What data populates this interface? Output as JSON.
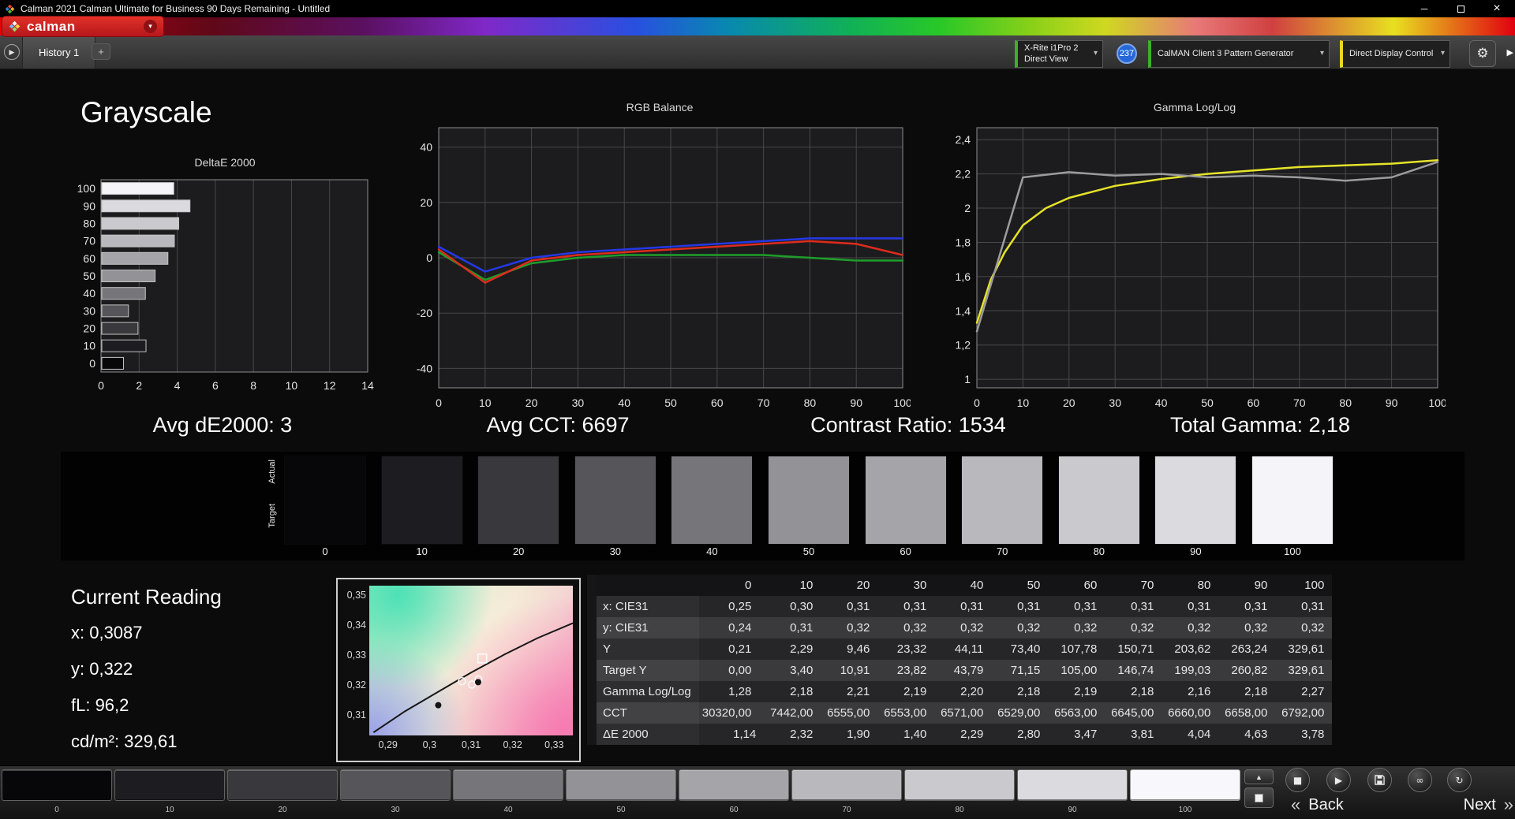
{
  "titlebar": {
    "title": "Calman 2021 Calman Ultimate for Business 90 Days Remaining  - Untitled",
    "minimize": "─",
    "close": "×"
  },
  "logo": {
    "text": "calman",
    "dropdown": "▾",
    "accent": "#cf2027"
  },
  "tabbar": {
    "history_tab": "History 1",
    "add_tab": "+",
    "nav_arrow": "▶"
  },
  "toolbar": {
    "meter": {
      "line1": "X-Rite i1Pro 2",
      "line2": "Direct View",
      "accent": "#3fae29",
      "dropdown": "▾"
    },
    "badge": "237",
    "pattern_generator": {
      "label": "CalMAN Client 3 Pattern Generator",
      "accent": "#3fae29",
      "dropdown": "▾"
    },
    "display_control": {
      "label": "Direct Display Control",
      "accent": "#e8d821",
      "dropdown": "▾"
    },
    "settings_icon": "⚙",
    "panel_arrow": "▶"
  },
  "page": {
    "title": "Grayscale"
  },
  "stats": {
    "avg_de": "Avg dE2000: 3",
    "avg_cct": "Avg CCT: 6697",
    "contrast": "Contrast Ratio: 1534",
    "total_gamma": "Total Gamma: 2,18"
  },
  "chart_data": [
    {
      "id": "deltae",
      "type": "bar",
      "title": "DeltaE 2000",
      "orientation": "horizontal",
      "categories": [
        100,
        90,
        80,
        70,
        60,
        50,
        40,
        30,
        20,
        10,
        0
      ],
      "values": [
        3.78,
        4.63,
        4.04,
        3.81,
        3.47,
        2.8,
        2.29,
        1.4,
        1.9,
        2.32,
        1.14
      ],
      "xlim": [
        0,
        14
      ],
      "xticks": [
        0,
        2,
        4,
        6,
        8,
        10,
        12,
        14
      ],
      "bar_colors": [
        "#f5f5f9",
        "#dbdbdf",
        "#cacace",
        "#b9b9bd",
        "#a5a5a9",
        "#939397",
        "#76767a",
        "#56565a",
        "#39393d",
        "#1d1d21",
        "#07070a"
      ]
    },
    {
      "id": "rgb",
      "type": "line",
      "title": "RGB Balance",
      "xlim": [
        0,
        100
      ],
      "ylim": [
        -47,
        47
      ],
      "xticks": [
        0,
        10,
        20,
        30,
        40,
        50,
        60,
        70,
        80,
        90,
        100
      ],
      "yticks": [
        {
          "v": 40,
          "label": "40"
        },
        {
          "v": 20,
          "label": "20"
        },
        {
          "v": 0,
          "label": "0"
        },
        {
          "v": -20,
          "label": "-20"
        },
        {
          "v": -40,
          "label": "-40"
        }
      ],
      "series": [
        {
          "name": "green",
          "color": "#1e9e2a",
          "points": [
            [
              0,
              2
            ],
            [
              10,
              -8
            ],
            [
              20,
              -2
            ],
            [
              30,
              0
            ],
            [
              40,
              1
            ],
            [
              50,
              1
            ],
            [
              60,
              1
            ],
            [
              70,
              1
            ],
            [
              80,
              0
            ],
            [
              90,
              -1
            ],
            [
              100,
              -1
            ]
          ]
        },
        {
          "name": "red",
          "color": "#de2b1c",
          "points": [
            [
              0,
              3
            ],
            [
              10,
              -9
            ],
            [
              20,
              -1
            ],
            [
              30,
              1
            ],
            [
              40,
              2
            ],
            [
              50,
              3
            ],
            [
              60,
              4
            ],
            [
              70,
              5
            ],
            [
              80,
              6
            ],
            [
              90,
              5
            ],
            [
              100,
              1
            ]
          ]
        },
        {
          "name": "blue",
          "color": "#2438e8",
          "points": [
            [
              0,
              4
            ],
            [
              10,
              -5
            ],
            [
              20,
              0
            ],
            [
              30,
              2
            ],
            [
              40,
              3
            ],
            [
              50,
              4
            ],
            [
              60,
              5
            ],
            [
              70,
              6
            ],
            [
              80,
              7
            ],
            [
              90,
              7
            ],
            [
              100,
              7
            ]
          ]
        }
      ]
    },
    {
      "id": "gamma",
      "type": "line",
      "title": "Gamma Log/Log",
      "xlim": [
        0,
        100
      ],
      "ylim": [
        0.95,
        2.47
      ],
      "xticks": [
        0,
        10,
        20,
        30,
        40,
        50,
        60,
        70,
        80,
        90,
        100
      ],
      "yticks": [
        {
          "v": 2.4,
          "label": "2,4"
        },
        {
          "v": 2.2,
          "label": "2,2"
        },
        {
          "v": 2.0,
          "label": "2"
        },
        {
          "v": 1.8,
          "label": "1,8"
        },
        {
          "v": 1.6,
          "label": "1,6"
        },
        {
          "v": 1.4,
          "label": "1,4"
        },
        {
          "v": 1.2,
          "label": "1,2"
        },
        {
          "v": 1.0,
          "label": "1"
        }
      ],
      "series": [
        {
          "name": "target",
          "color": "#e6e32a",
          "points": [
            [
              0,
              1.33
            ],
            [
              3,
              1.58
            ],
            [
              6,
              1.74
            ],
            [
              10,
              1.9
            ],
            [
              15,
              2.0
            ],
            [
              20,
              2.06
            ],
            [
              30,
              2.13
            ],
            [
              40,
              2.17
            ],
            [
              50,
              2.2
            ],
            [
              60,
              2.22
            ],
            [
              70,
              2.24
            ],
            [
              80,
              2.25
            ],
            [
              90,
              2.26
            ],
            [
              100,
              2.28
            ]
          ]
        },
        {
          "name": "measured",
          "color": "#9c9c9e",
          "points": [
            [
              0,
              1.28
            ],
            [
              10,
              2.18
            ],
            [
              20,
              2.21
            ],
            [
              30,
              2.19
            ],
            [
              40,
              2.2
            ],
            [
              50,
              2.18
            ],
            [
              60,
              2.19
            ],
            [
              70,
              2.18
            ],
            [
              80,
              2.16
            ],
            [
              90,
              2.18
            ],
            [
              100,
              2.27
            ]
          ]
        }
      ]
    },
    {
      "id": "cie",
      "type": "scatter",
      "title": "CIE xy",
      "xlim": [
        0.2855,
        0.3345
      ],
      "ylim": [
        0.3035,
        0.3535
      ],
      "xticks": [
        {
          "v": 0.29,
          "label": "0,29"
        },
        {
          "v": 0.3,
          "label": "0,3"
        },
        {
          "v": 0.31,
          "label": "0,31"
        },
        {
          "v": 0.32,
          "label": "0,32"
        },
        {
          "v": 0.33,
          "label": "0,33"
        }
      ],
      "yticks": [
        {
          "v": 0.35,
          "label": "0,35"
        },
        {
          "v": 0.34,
          "label": "0,34"
        },
        {
          "v": 0.33,
          "label": "0,33"
        },
        {
          "v": 0.32,
          "label": "0,32"
        },
        {
          "v": 0.31,
          "label": "0,31"
        }
      ],
      "locus": [
        [
          0.2865,
          0.3045
        ],
        [
          0.294,
          0.3115
        ],
        [
          0.302,
          0.318
        ],
        [
          0.31,
          0.3245
        ],
        [
          0.318,
          0.3305
        ],
        [
          0.326,
          0.336
        ],
        [
          0.3345,
          0.341
        ]
      ],
      "points": [
        {
          "shape": "square",
          "x": 0.3127,
          "y": 0.3292
        },
        {
          "shape": "circle",
          "x": 0.3078,
          "y": 0.3216
        },
        {
          "shape": "circle",
          "x": 0.3102,
          "y": 0.3205
        },
        {
          "shape": "circle",
          "x": 0.3118,
          "y": 0.3222
        },
        {
          "shape": "dot",
          "x": 0.3021,
          "y": 0.3136
        },
        {
          "shape": "dot",
          "x": 0.3117,
          "y": 0.3213
        }
      ]
    }
  ],
  "swatch_strip": {
    "row_labels": [
      "Actual",
      "Target"
    ],
    "labels": [
      "0",
      "10",
      "20",
      "30",
      "40",
      "50",
      "60",
      "70",
      "80",
      "90",
      "100"
    ],
    "colors": [
      "#07070a",
      "#1d1d21",
      "#39393d",
      "#56565a",
      "#76767a",
      "#939397",
      "#a5a5a9",
      "#b9b9bd",
      "#cacace",
      "#dbdbdf",
      "#f5f5f9"
    ]
  },
  "current_reading": {
    "title": "Current Reading",
    "lines": [
      "x: 0,3087",
      "y: 0,322",
      "fL: 96,2",
      "cd/m²: 329,61"
    ]
  },
  "table": {
    "columns": [
      "",
      "0",
      "10",
      "20",
      "30",
      "40",
      "50",
      "60",
      "70",
      "80",
      "90",
      "100"
    ],
    "rows": [
      {
        "label": "x: CIE31",
        "values": [
          "0,25",
          "0,30",
          "0,31",
          "0,31",
          "0,31",
          "0,31",
          "0,31",
          "0,31",
          "0,31",
          "0,31",
          "0,31"
        ]
      },
      {
        "label": "y: CIE31",
        "values": [
          "0,24",
          "0,31",
          "0,32",
          "0,32",
          "0,32",
          "0,32",
          "0,32",
          "0,32",
          "0,32",
          "0,32",
          "0,32"
        ]
      },
      {
        "label": "Y",
        "values": [
          "0,21",
          "2,29",
          "9,46",
          "23,32",
          "44,11",
          "73,40",
          "107,78",
          "150,71",
          "203,62",
          "263,24",
          "329,61"
        ]
      },
      {
        "label": "Target Y",
        "values": [
          "0,00",
          "3,40",
          "10,91",
          "23,82",
          "43,79",
          "71,15",
          "105,00",
          "146,74",
          "199,03",
          "260,82",
          "329,61"
        ]
      },
      {
        "label": "Gamma Log/Log",
        "values": [
          "1,28",
          "2,18",
          "2,21",
          "2,19",
          "2,20",
          "2,18",
          "2,19",
          "2,18",
          "2,16",
          "2,18",
          "2,27"
        ]
      },
      {
        "label": "CCT",
        "values": [
          "30320,00",
          "7442,00",
          "6555,00",
          "6553,00",
          "6571,00",
          "6529,00",
          "6563,00",
          "6645,00",
          "6660,00",
          "6658,00",
          "6792,00"
        ]
      },
      {
        "label": "ΔE 2000",
        "values": [
          "1,14",
          "2,32",
          "1,90",
          "1,40",
          "2,29",
          "2,80",
          "3,47",
          "3,81",
          "4,04",
          "4,63",
          "3,78"
        ]
      }
    ]
  },
  "bottom": {
    "labels": [
      "0",
      "10",
      "20",
      "30",
      "40",
      "50",
      "60",
      "70",
      "80",
      "90",
      "100"
    ],
    "colors": [
      "#07070a",
      "#1d1d21",
      "#39393d",
      "#56565a",
      "#76767a",
      "#939397",
      "#a5a5a9",
      "#b9b9bd",
      "#cacace",
      "#dbdbdf",
      "#f8f8fc"
    ],
    "selected_index": 10,
    "controls": {
      "pattern_up": "▲",
      "stop": "■",
      "play": "▶",
      "link": "∞",
      "refresh": "↻"
    },
    "back_icon": "«",
    "back": "Back",
    "next": "Next",
    "next_icon": "»"
  }
}
